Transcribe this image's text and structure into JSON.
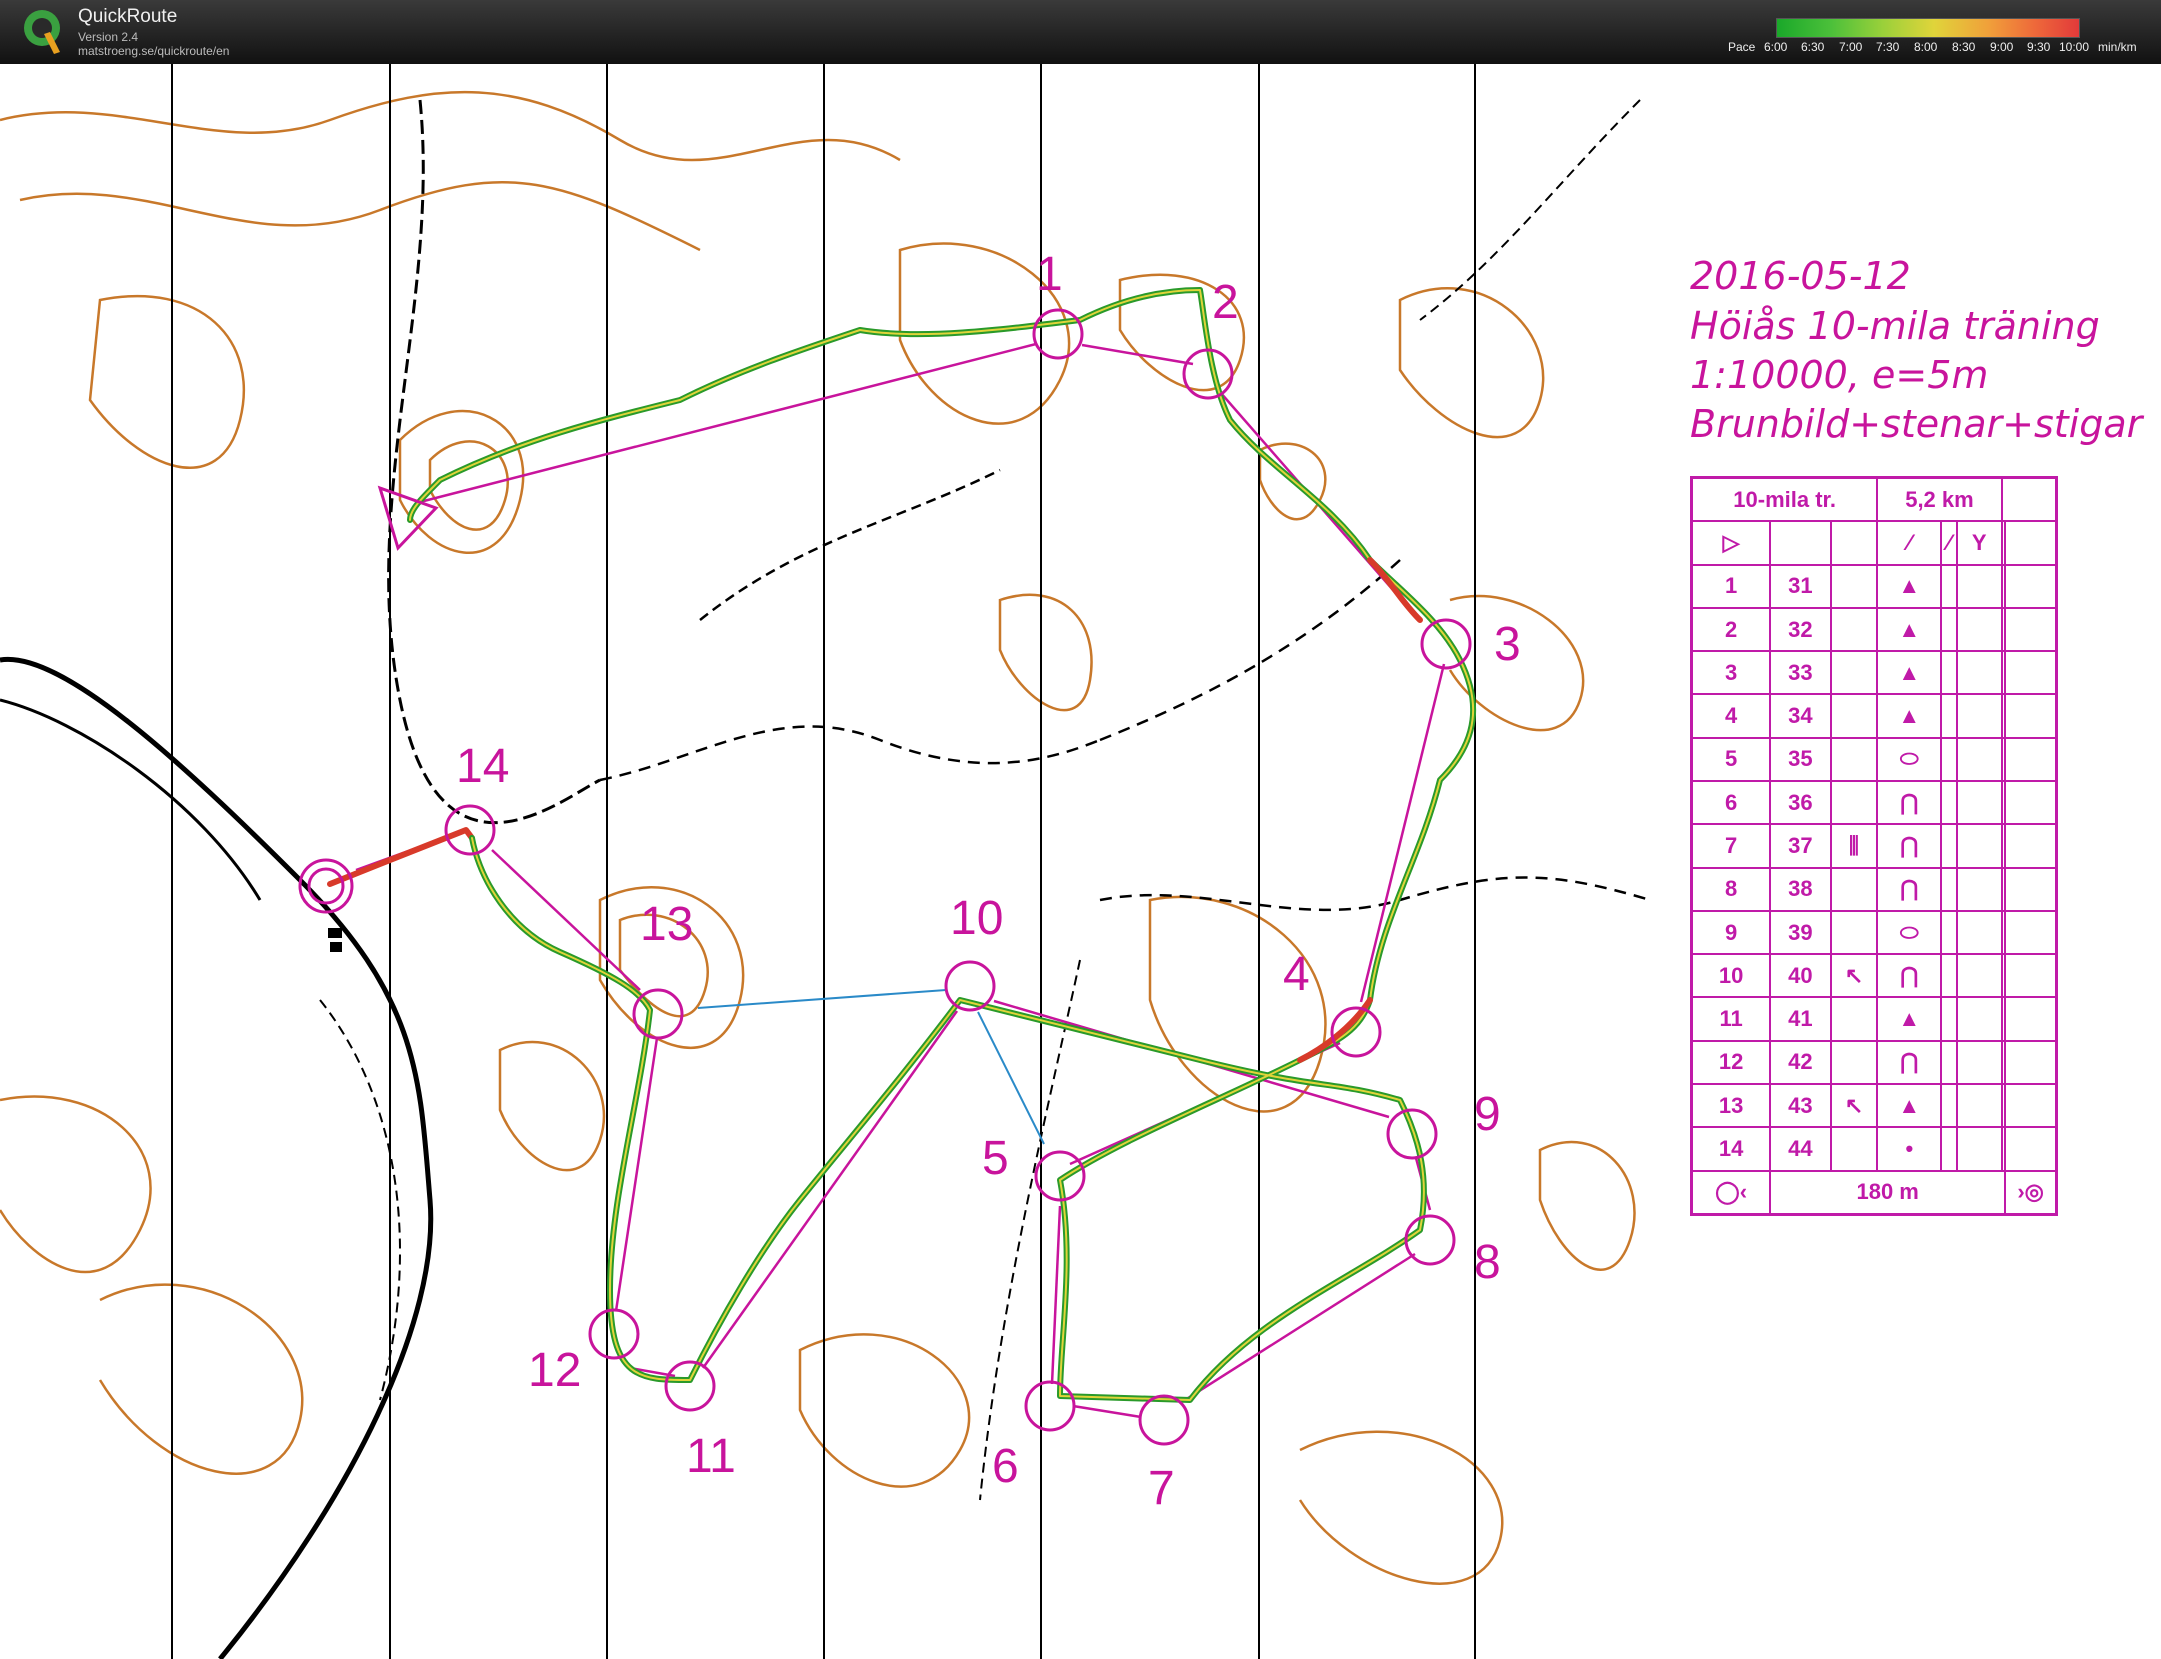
{
  "app": {
    "name": "QuickRoute",
    "version": "Version 2.4",
    "url": "matstroeng.se/quickroute/en"
  },
  "pace_scale": {
    "label": "Pace",
    "ticks": [
      "6:00",
      "6:30",
      "7:00",
      "7:30",
      "8:00",
      "8:30",
      "9:00",
      "9:30",
      "10:00"
    ],
    "unit": "min/km",
    "colors": [
      "#1aa82a",
      "#e0d43a",
      "#e23a3a"
    ]
  },
  "map_info": {
    "date": "2016-05-12",
    "event": "Höiås 10-mila träning",
    "scale": "1:10000, e=5m",
    "map_type": "Brunbild+stenar+stigar"
  },
  "course": {
    "name": "10-mila tr.",
    "length": "5,2 km",
    "finish_distance": "180 m",
    "controls": [
      {
        "num": "1",
        "code": "31",
        "col_d": "",
        "symbol": "▲"
      },
      {
        "num": "2",
        "code": "32",
        "col_d": "",
        "symbol": "▲"
      },
      {
        "num": "3",
        "code": "33",
        "col_d": "",
        "symbol": "▲"
      },
      {
        "num": "4",
        "code": "34",
        "col_d": "",
        "symbol": "▲"
      },
      {
        "num": "5",
        "code": "35",
        "col_d": "",
        "symbol": "⬭"
      },
      {
        "num": "6",
        "code": "36",
        "col_d": "",
        "symbol": "⋂"
      },
      {
        "num": "7",
        "code": "37",
        "col_d": "⫼",
        "symbol": "⋂"
      },
      {
        "num": "8",
        "code": "38",
        "col_d": "",
        "symbol": "⋂"
      },
      {
        "num": "9",
        "code": "39",
        "col_d": "",
        "symbol": "⬭"
      },
      {
        "num": "10",
        "code": "40",
        "col_d": "↖",
        "symbol": "⋂"
      },
      {
        "num": "11",
        "code": "41",
        "col_d": "",
        "symbol": "▲"
      },
      {
        "num": "12",
        "code": "42",
        "col_d": "",
        "symbol": "⋂"
      },
      {
        "num": "13",
        "code": "43",
        "col_d": "↖",
        "symbol": "▲"
      },
      {
        "num": "14",
        "code": "44",
        "col_d": "",
        "symbol": "•"
      }
    ]
  },
  "map_labels": [
    "1",
    "2",
    "3",
    "4",
    "5",
    "6",
    "7",
    "8",
    "9",
    "10",
    "11",
    "12",
    "13",
    "14"
  ],
  "colors": {
    "course": "#c8149c",
    "contour": "#c8782a",
    "route_fast": "#2a9a2a",
    "route_slow": "#d83a2a"
  }
}
